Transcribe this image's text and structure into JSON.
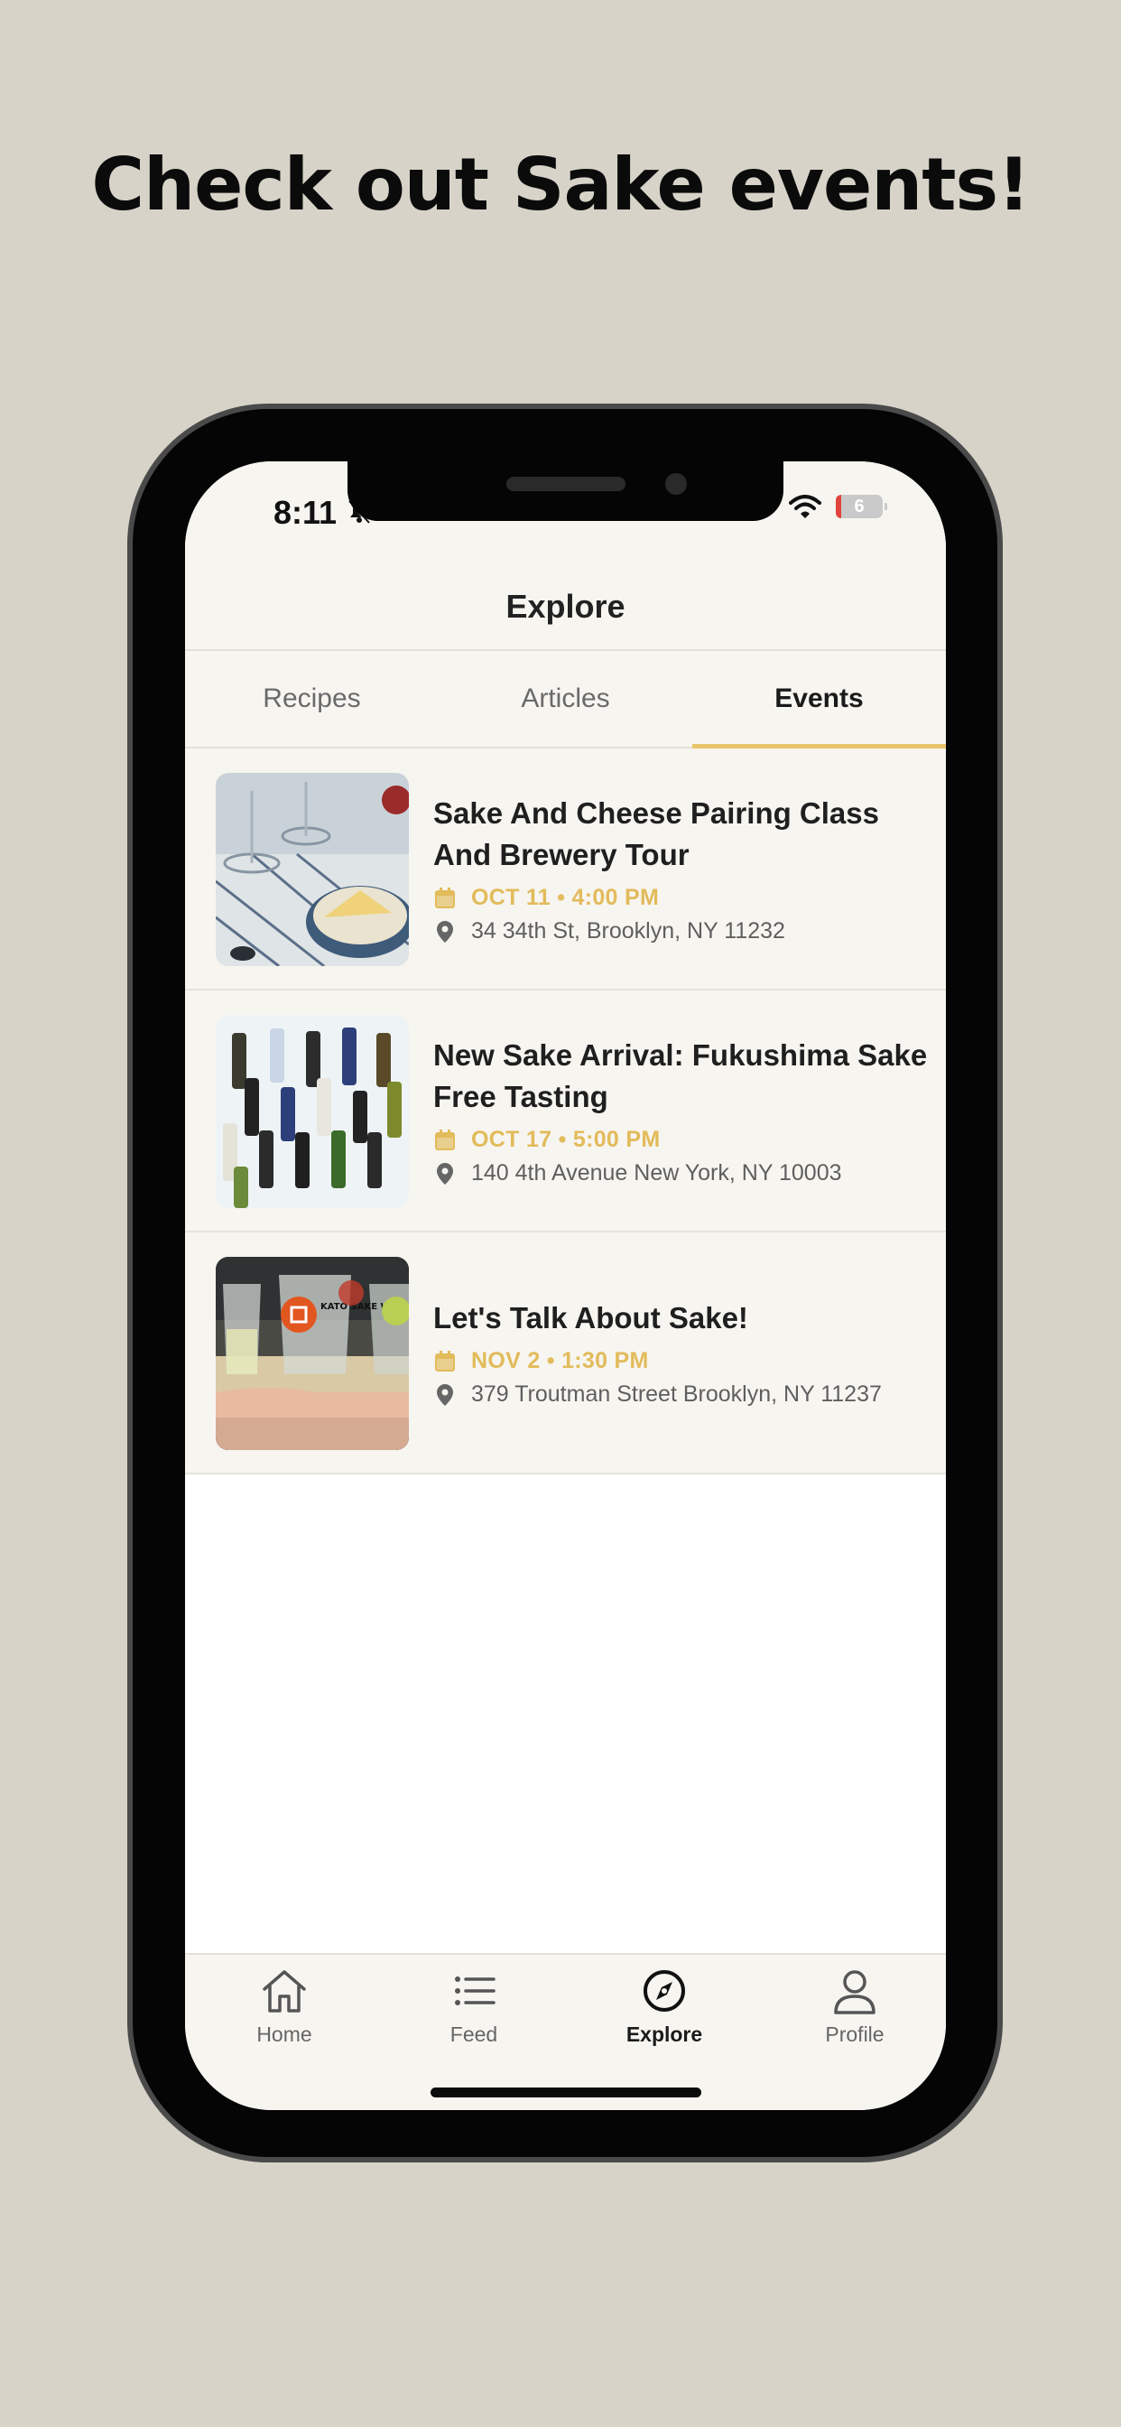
{
  "headline": "Check out Sake events!",
  "status": {
    "time": "8:11",
    "battery": "6"
  },
  "nav": {
    "title": "Explore"
  },
  "tabs": [
    {
      "label": "Recipes",
      "active": false
    },
    {
      "label": "Articles",
      "active": false
    },
    {
      "label": "Events",
      "active": true
    }
  ],
  "events": [
    {
      "title": "Sake And Cheese Pairing Class And Brewery Tour",
      "date": "OCT 11 • 4:00 PM",
      "address": "34 34th St, Brooklyn, NY 11232",
      "image": "cheese-pairing-photo"
    },
    {
      "title": "New Sake Arrival: Fukushima Sake Free Tasting",
      "date": "OCT 17 • 5:00 PM",
      "address": "140 4th Avenue New York, NY 10003",
      "image": "sake-bottles-photo"
    },
    {
      "title": "Let's Talk About Sake!",
      "date": "NOV 2 • 1:30 PM",
      "address": "379 Troutman Street Brooklyn, NY 11237",
      "image": "sake-glasses-photo",
      "logo_text": "KATO SAKE WORKS"
    }
  ],
  "tabbar": [
    {
      "label": "Home",
      "icon": "house-icon",
      "active": false
    },
    {
      "label": "Feed",
      "icon": "list-icon",
      "active": false
    },
    {
      "label": "Explore",
      "icon": "compass-icon",
      "active": true
    },
    {
      "label": "Profile",
      "icon": "person-icon",
      "active": false
    }
  ],
  "colors": {
    "accent": "#e8c56a",
    "date": "#e2bb5a",
    "background": "#d7d3c8",
    "surface": "#f7f5f0"
  }
}
